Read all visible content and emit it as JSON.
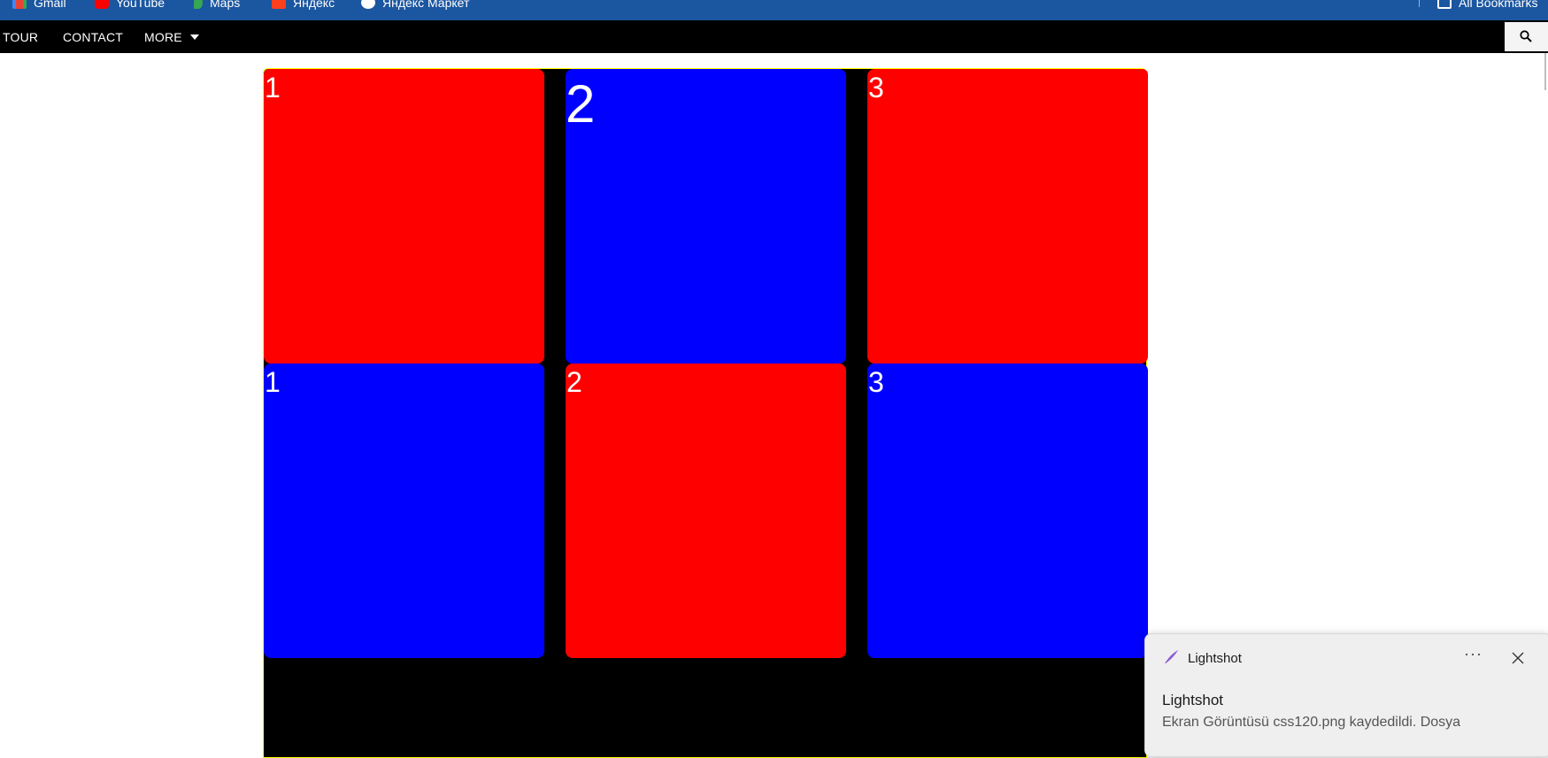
{
  "bookmarks_bar": {
    "items": [
      {
        "label": "Gmail",
        "icon": "gmail-icon"
      },
      {
        "label": "YouTube",
        "icon": "youtube-icon"
      },
      {
        "label": "Maps",
        "icon": "maps-icon"
      },
      {
        "label": "Яндекс",
        "icon": "yandex-icon"
      },
      {
        "label": "Яндекс Маркет",
        "icon": "yandex-market-icon"
      }
    ],
    "all_bookmarks": "All Bookmarks"
  },
  "navbar": {
    "items": [
      "TOUR",
      "CONTACT",
      "MORE"
    ],
    "search_icon": "search-icon"
  },
  "grid": {
    "cells": [
      {
        "label": "1",
        "color": "#ff0000"
      },
      {
        "label": "2",
        "color": "#0000ff"
      },
      {
        "label": "3",
        "color": "#ff0000"
      },
      {
        "label": "1",
        "color": "#0000ff"
      },
      {
        "label": "2",
        "color": "#ff0000"
      },
      {
        "label": "3",
        "color": "#0000ff"
      }
    ],
    "border_color": "#ffff00",
    "background": "#000000"
  },
  "notification": {
    "app_name": "Lightshot",
    "title": "Lightshot",
    "message": "Ekran Görüntüsü css120.png kaydedildi. Dosya"
  }
}
